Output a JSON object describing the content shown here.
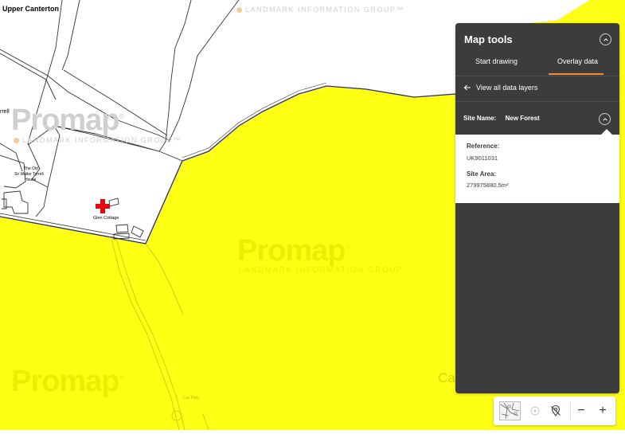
{
  "map": {
    "place_labels": {
      "upper_canterton": "Upper Canterton",
      "the_old": "The Old",
      "sir_walter": "Sir Walter Tyrrell",
      "house": "House",
      "glen_cottage": "Glen Cottage",
      "yrrell": "rrell",
      "car_park": "Car Park",
      "ca": "Ca"
    },
    "watermark": {
      "brand": "Promap",
      "registered": "®",
      "company": "LANDMARK INFORMATION GROUP",
      "company_tm": "LANDMARK INFORMATION GROUP™"
    },
    "colors": {
      "overlay": "#ffff14",
      "linework": "#333333",
      "hospital_cross": "#e30613",
      "watermark_accent": "#f08c2e"
    }
  },
  "panel": {
    "title": "Map tools",
    "tabs": [
      {
        "label": "Start drawing",
        "active": false
      },
      {
        "label": "Overlay data",
        "active": true
      }
    ],
    "back_link": "View all data layers",
    "site_name_label": "Site Name:",
    "site_name_value": "New Forest",
    "details": {
      "reference_label": "Reference:",
      "reference_value": "UK9011031",
      "area_label": "Site Area:",
      "area_value": "279975880.5m²"
    }
  },
  "toolbar": {
    "items": [
      {
        "icon": "basemap-thumbnail-icon"
      },
      {
        "icon": "locate-icon"
      },
      {
        "icon": "location-off-icon"
      }
    ],
    "zoom_out": "−",
    "zoom_in": "+"
  }
}
